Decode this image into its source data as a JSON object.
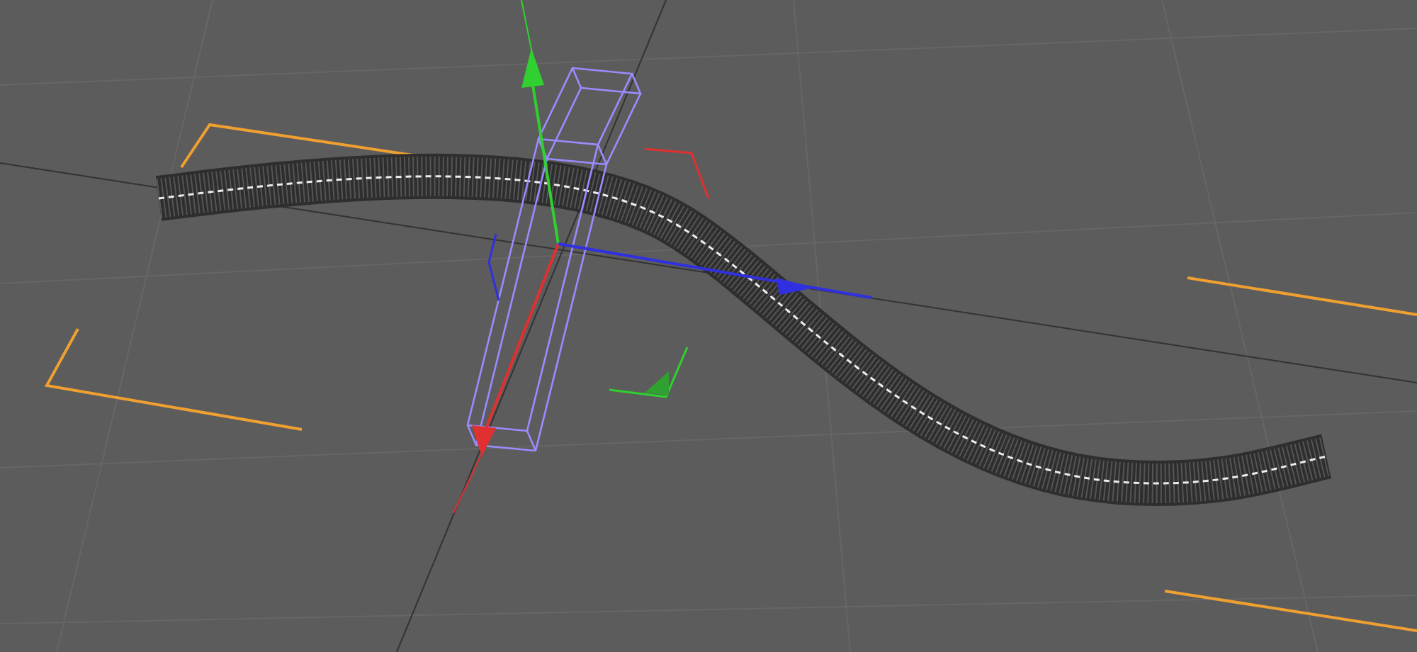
{
  "viewport": {
    "grid": true,
    "selected": true
  }
}
